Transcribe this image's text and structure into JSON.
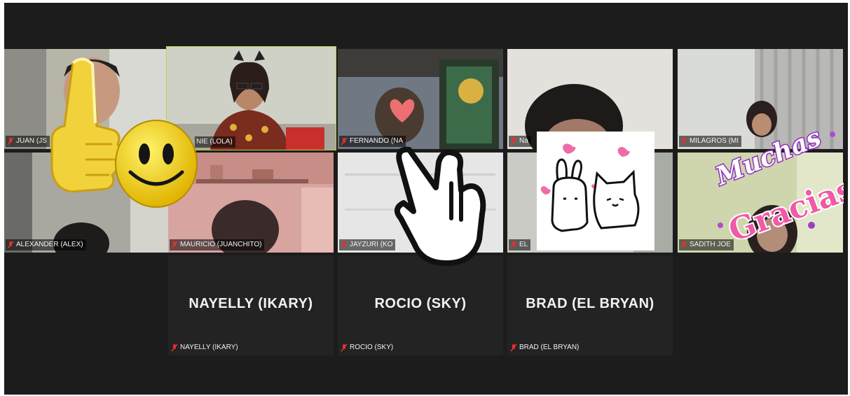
{
  "participants": [
    {
      "label": "JUAN (JS",
      "muted": true
    },
    {
      "label": "NIE (LOLA)",
      "muted": false,
      "active_speaker": true
    },
    {
      "label": "FERNANDO (NA",
      "muted": true
    },
    {
      "label": "Na",
      "muted": true
    },
    {
      "label": "MILAGROS (MI",
      "muted": true
    },
    {
      "label": "ALEXANDER (ALEX)",
      "muted": true
    },
    {
      "label": "MAURICIO (JUANCHITO)",
      "muted": true
    },
    {
      "label": "JAYZURI (KO",
      "muted": true
    },
    {
      "label": "EL",
      "muted": true
    },
    {
      "label": "SADITH JOE",
      "muted": true
    },
    {
      "label": "NAYELLY (IKARY)",
      "display": "NAYELLY (IKARY)",
      "muted": true
    },
    {
      "label": "ROCIO (SKY)",
      "display": "ROCIO (SKY)",
      "muted": true
    },
    {
      "label": "BRAD (EL BRYAN)",
      "display": "BRAD (EL BRYAN)",
      "muted": true
    }
  ],
  "stickers": {
    "thanks_line1": "Muchas",
    "thanks_line2": "Gracias"
  },
  "colors": {
    "background": "#1c1c1c",
    "active_border": "#b9d442",
    "muted_icon": "#e0322e"
  }
}
